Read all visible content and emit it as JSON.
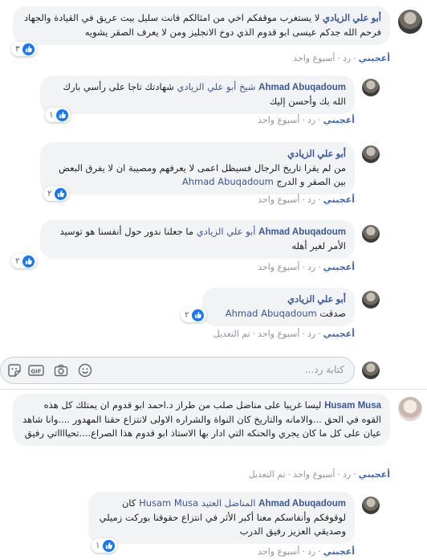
{
  "comments": [
    {
      "author": "أبو علي الزيادي",
      "text": "لا يستغرب موقفكم اخي من امثالكم فانت سليل بيت عريق في القيادة والجهاد فرحم الله جدكم عيسى ابو قدوم الذي دوخ الانجليز ومن لا يعرف الصقر يشويه",
      "reaction_count": "٣",
      "like_label": "أعجبني",
      "reply_label": "رد",
      "time": "أسبوع واحد"
    }
  ],
  "replies": [
    {
      "author": "Ahmad Abuqadoum",
      "mention": "شيخ أبو علي الزيادي",
      "text": "شهادتك تاجا على رأسي بارك الله بك وأحسن إليك",
      "reaction_count": "١",
      "like_label": "أعجبني",
      "reply_label": "رد",
      "time": "أسبوع واحد"
    },
    {
      "author": "أبو علي الزيادي",
      "mention": "Ahmad Abuqadoum",
      "text": "من لم يقرا تاريخ الرجال فسيظل اعمى لا يعرفهم ومصيبة ان لا يفرق البعض بين الصقر و الدرج",
      "reaction_count": "٢",
      "like_label": "أعجبني",
      "reply_label": "رد",
      "time": "أسبوع واحد"
    },
    {
      "author": "Ahmad Abuqadoum",
      "mention": "أبو علي الزيادي",
      "text": "ما جعلنا ندور حول أنفسنا هو توسيد الأمر لغير أهله",
      "reaction_count": "٢",
      "like_label": "أعجبني",
      "reply_label": "رد",
      "time": "أسبوع واحد"
    },
    {
      "author": "أبو علي الزيادي",
      "mention": "Ahmad Abuqadoum",
      "text": "صدقت",
      "reaction_count": "٢",
      "like_label": "أعجبني",
      "reply_label": "رد",
      "time": "أسبوع واحد",
      "edited": "تم التعديل"
    }
  ],
  "composer": {
    "placeholder": "كتابة رد..."
  },
  "thread2": {
    "comment": {
      "author": "Husam Musa",
      "text": "ليسا غريبا على مناضل صلب من طراز د.احمد ابو قدوم ان يمتلك كل هذه القوه في الحق ...والامانه والتاريخ كان النواة والشراره الاولى لانتزاع حقنا المهدور ....وانا شاهد عيان على كل ما كان يجري والحنكه التي ادار بها الاستاذ ابو قدوم هذا الصراع....تحيااااتي رفيق",
      "like_label": "أعجبني",
      "reply_label": "رد",
      "time": "أسبوع واحد",
      "edited": "تم التعديل"
    },
    "reply": {
      "author": "Ahmad Abuqadoum",
      "mention": "المناضل العتيد Husam Musa",
      "text": "كان لوقوفكم وأنفاسكم معنا أكبر الأثر في انتزاع حقوقنا بوركت زميلي وصديقي العزيز رفيق الدرب",
      "reaction_count": "١",
      "like_label": "أعجبني",
      "reply_label": "رد",
      "time": "أسبوع واحد"
    }
  },
  "colors": {
    "link": "#385898",
    "bubble": "#f2f3f5",
    "like": "#1877f2"
  }
}
